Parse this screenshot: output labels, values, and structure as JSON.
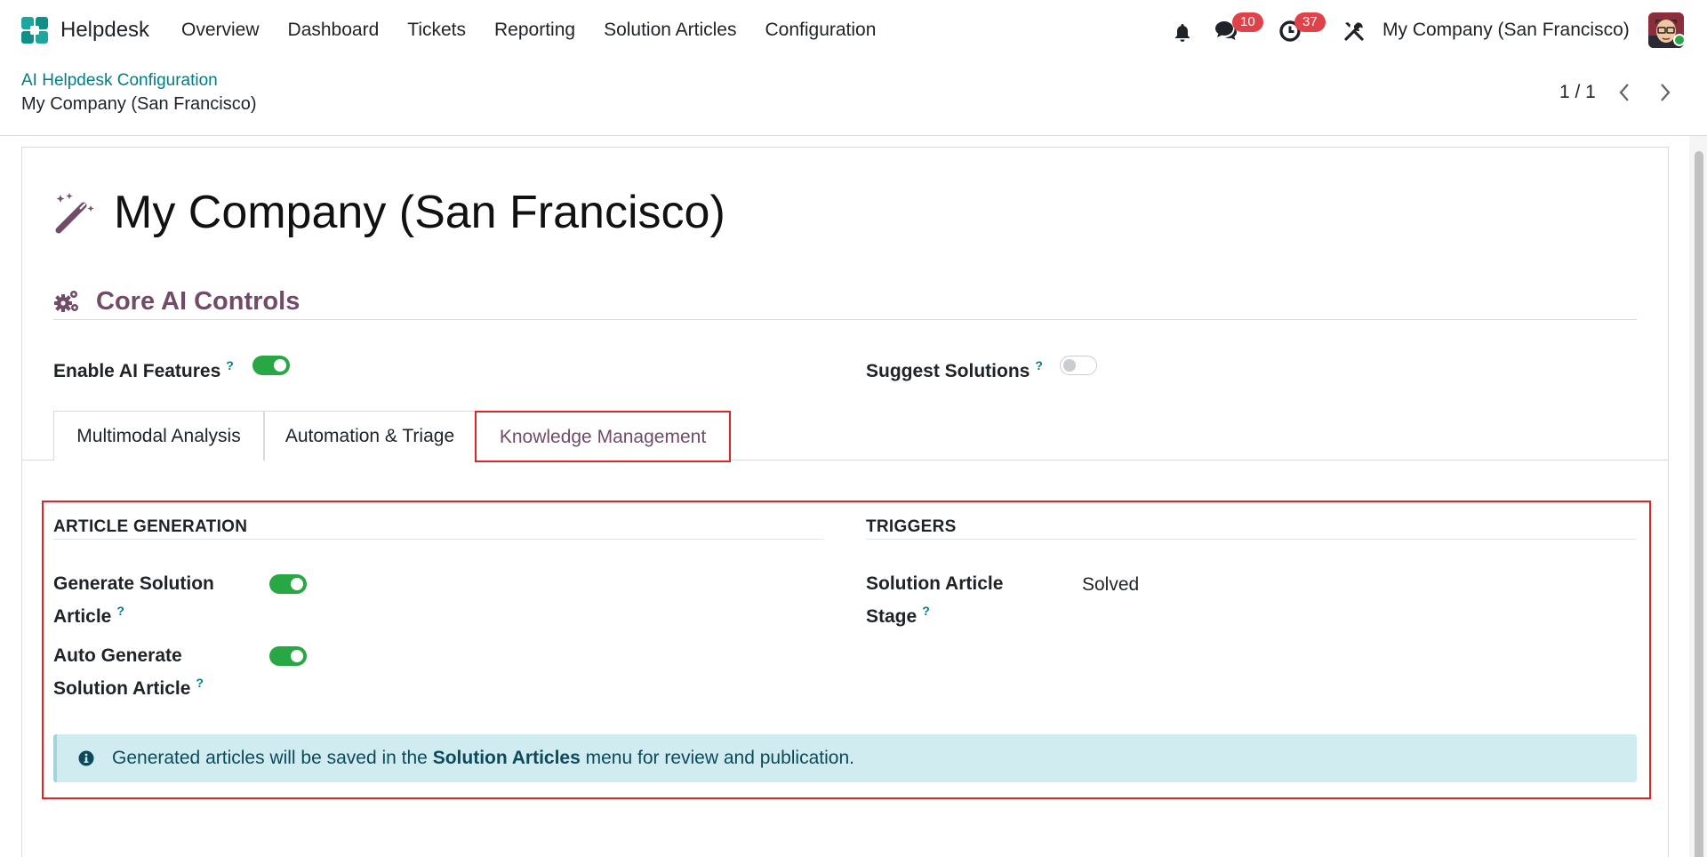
{
  "navbar": {
    "app_name": "Helpdesk",
    "menu": [
      {
        "label": "Overview"
      },
      {
        "label": "Dashboard"
      },
      {
        "label": "Tickets"
      },
      {
        "label": "Reporting"
      },
      {
        "label": "Solution Articles"
      },
      {
        "label": "Configuration"
      }
    ],
    "messages_count": "10",
    "activities_count": "37",
    "company": "My Company (San Francisco)",
    "icons": [
      "helpdesk-logo-icon",
      "bell-icon",
      "chat-icon",
      "clock-icon",
      "tools-icon",
      "avatar"
    ]
  },
  "control_panel": {
    "breadcrumb_parent": "AI Helpdesk Configuration",
    "breadcrumb_current": "My Company (San Francisco)",
    "pager": "1 / 1"
  },
  "form": {
    "title": "My Company (San Francisco)",
    "title_icon": "magic-wand-icon",
    "section": {
      "title": "Core AI Controls",
      "icon": "gears-icon",
      "fields": [
        {
          "label": "Enable AI Features",
          "help": "?",
          "value": true
        },
        {
          "label": "Suggest Solutions",
          "help": "?",
          "value": false
        }
      ]
    },
    "tabs": [
      {
        "label": "Multimodal Analysis",
        "active": false
      },
      {
        "label": "Automation & Triage",
        "active": false
      },
      {
        "label": "Knowledge Management",
        "active": true
      }
    ],
    "knowledge": {
      "article_generation": {
        "title": "ARTICLE GENERATION",
        "fields": [
          {
            "label": "Generate Solution Article",
            "help": "?",
            "value": true
          },
          {
            "label": "Auto Generate Solution Article",
            "help": "?",
            "value": true
          }
        ]
      },
      "triggers": {
        "title": "TRIGGERS",
        "fields": [
          {
            "label": "Solution Article Stage",
            "help": "?",
            "value": "Solved"
          }
        ]
      },
      "alert": {
        "prefix": "Generated articles will be saved in the ",
        "emphasis": "Solution Articles",
        "suffix": " menu for review and publication.",
        "icon": "info-circle-icon"
      }
    }
  },
  "colors": {
    "brand": "#714b67",
    "link": "#017e84",
    "toggle_on": "#28a745",
    "badge": "#e0424a",
    "highlight": "#e02424",
    "alert_bg": "#d1ecf1"
  }
}
